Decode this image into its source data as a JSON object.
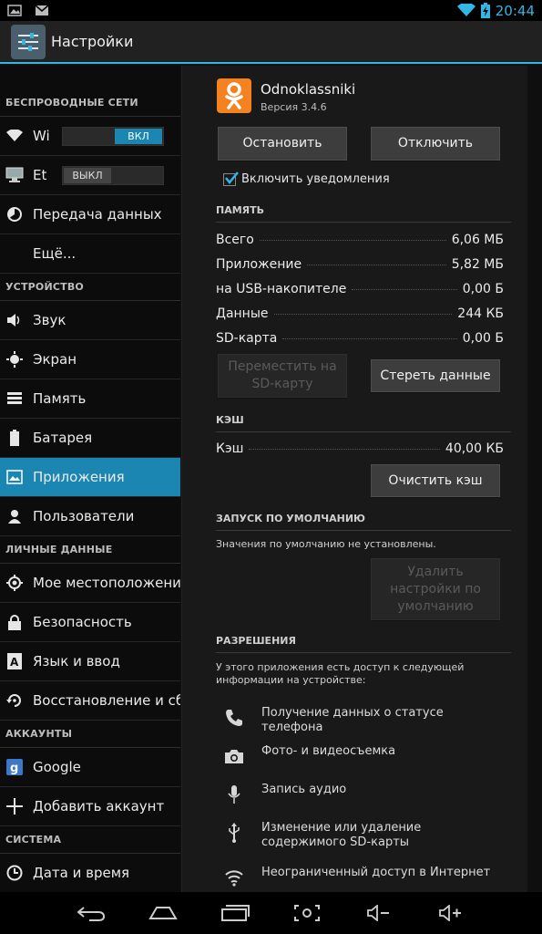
{
  "status_bar": {
    "time": "20:44",
    "icons_left": [
      "image-icon",
      "mail-icon"
    ],
    "icons_right": [
      "wifi-icon",
      "battery-charging-icon"
    ]
  },
  "action_bar": {
    "title": "Настройки",
    "icon": "settings-icon"
  },
  "sidebar": {
    "sections": [
      {
        "header": "БЕСПРОВОДНЫЕ СЕТИ",
        "items": [
          {
            "label": "Wi",
            "icon": "wifi-icon",
            "toggle": "ВКЛ",
            "toggle_state": "on"
          },
          {
            "label": "Et",
            "icon": "ethernet-icon",
            "toggle": "ВЫКЛ",
            "toggle_state": "off"
          },
          {
            "label": "Передача данных",
            "icon": "data-usage-icon"
          },
          {
            "label": "Ещё...",
            "icon": ""
          }
        ]
      },
      {
        "header": "УСТРОЙСТВО",
        "items": [
          {
            "label": "Звук",
            "icon": "sound-icon"
          },
          {
            "label": "Экран",
            "icon": "display-icon"
          },
          {
            "label": "Память",
            "icon": "storage-icon"
          },
          {
            "label": "Батарея",
            "icon": "battery-icon"
          },
          {
            "label": "Приложения",
            "icon": "apps-icon",
            "active": true
          },
          {
            "label": "Пользователи",
            "icon": "users-icon"
          }
        ]
      },
      {
        "header": "ЛИЧНЫЕ ДАННЫЕ",
        "items": [
          {
            "label": "Мое местоположение",
            "icon": "location-icon"
          },
          {
            "label": "Безопасность",
            "icon": "lock-icon"
          },
          {
            "label": "Язык и ввод",
            "icon": "language-icon"
          },
          {
            "label": "Восстановление и сброс",
            "icon": "backup-icon"
          }
        ]
      },
      {
        "header": "АККАУНТЫ",
        "items": [
          {
            "label": "Google",
            "icon": "google-icon"
          },
          {
            "label": "Добавить аккаунт",
            "icon": "plus-icon"
          }
        ]
      },
      {
        "header": "СИСТЕМА",
        "items": [
          {
            "label": "Дата и время",
            "icon": "clock-icon"
          }
        ]
      }
    ]
  },
  "app": {
    "name": "Odnoklassniki",
    "version": "Версия 3.4.6",
    "stop_button": "Остановить",
    "disable_button": "Отключить",
    "notifications_label": "Включить уведомления",
    "notifications_checked": true
  },
  "memory": {
    "header": "ПАМЯТЬ",
    "rows": [
      {
        "key": "Всего",
        "value": "6,06 МБ"
      },
      {
        "key": "Приложение",
        "value": "5,82 МБ"
      },
      {
        "key": "на USB-накопителе",
        "value": "0,00 Б"
      },
      {
        "key": "Данные",
        "value": "244 КБ"
      },
      {
        "key": "SD-карта",
        "value": "0,00 Б"
      }
    ],
    "move_button": "Переместить на SD-карту",
    "clear_data_button": "Стереть данные"
  },
  "cache": {
    "header": "КЭШ",
    "rows": [
      {
        "key": "Кэш",
        "value": "40,00 КБ"
      }
    ],
    "clear_cache_button": "Очистить кэш"
  },
  "defaults": {
    "header": "ЗАПУСК ПО УМОЛЧАНИЮ",
    "note": "Значения по умолчанию не установлены.",
    "clear_defaults_button": "Удалить настройки по умолчанию"
  },
  "permissions": {
    "header": "РАЗРЕШЕНИЯ",
    "intro": "У этого приложения есть доступ к следующей информации на устройстве:",
    "items": [
      {
        "icon": "phone-icon",
        "text": "Получение данных о статусе телефона"
      },
      {
        "icon": "camera-icon",
        "text": "Фото- и видеосъемка"
      },
      {
        "icon": "microphone-icon",
        "text": "Запись аудио"
      },
      {
        "icon": "usb-icon",
        "text": "Изменение или удаление содержимого SD-карты"
      },
      {
        "icon": "wifi-icon",
        "text": "Неограниченный доступ в Интернет"
      }
    ]
  },
  "nav_bar": {
    "buttons": [
      "back-icon",
      "home-icon",
      "recent-apps-icon",
      "screenshot-icon",
      "volume-down-icon",
      "volume-up-icon"
    ]
  },
  "colors": {
    "accent": "#33b5e5",
    "active_item": "#1c86b3",
    "app_logo": "#f58220"
  }
}
